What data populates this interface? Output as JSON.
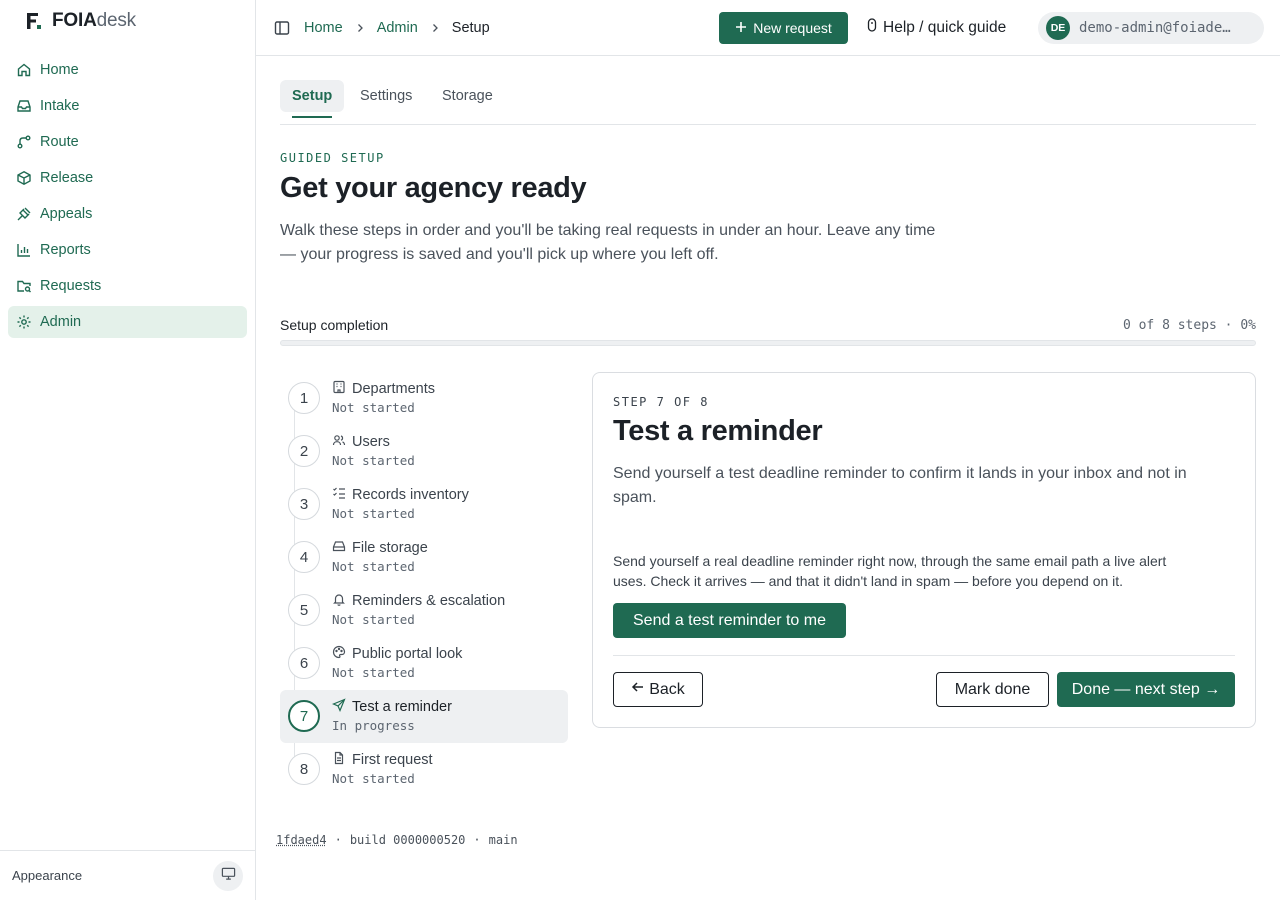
{
  "brand": {
    "name_bold": "FOIA",
    "name_light": "desk"
  },
  "sidebar": {
    "items": [
      {
        "label": "Home",
        "icon": "home-icon"
      },
      {
        "label": "Intake",
        "icon": "inbox-icon"
      },
      {
        "label": "Route",
        "icon": "route-icon"
      },
      {
        "label": "Release",
        "icon": "package-icon"
      },
      {
        "label": "Appeals",
        "icon": "gavel-icon"
      },
      {
        "label": "Reports",
        "icon": "bar-chart-icon"
      },
      {
        "label": "Requests",
        "icon": "folder-search-icon"
      },
      {
        "label": "Admin",
        "icon": "gear-icon",
        "active": true
      }
    ],
    "appearance_label": "Appearance"
  },
  "topbar": {
    "breadcrumbs": [
      "Home",
      "Admin",
      "Setup"
    ],
    "new_request_label": "New request",
    "help_label": "Help / quick guide",
    "user_initials": "DE",
    "user_email": "demo-admin@foiade…"
  },
  "tabs": [
    "Setup",
    "Settings",
    "Storage"
  ],
  "header": {
    "eyebrow": "GUIDED SETUP",
    "title": "Get your agency ready",
    "intro": "Walk these steps in order and you'll be taking real requests in under an hour. Leave any time — your progress is saved and you'll pick up where you left off."
  },
  "completion": {
    "label": "Setup completion",
    "count_text": "0 of 8 steps · 0%",
    "percent": 0
  },
  "steps": [
    {
      "number": "1",
      "title": "Departments",
      "status": "Not started",
      "icon": "building-icon"
    },
    {
      "number": "2",
      "title": "Users",
      "status": "Not started",
      "icon": "users-icon"
    },
    {
      "number": "3",
      "title": "Records inventory",
      "status": "Not started",
      "icon": "list-checks-icon"
    },
    {
      "number": "4",
      "title": "File storage",
      "status": "Not started",
      "icon": "hard-drive-icon"
    },
    {
      "number": "5",
      "title": "Reminders & escalation",
      "status": "Not started",
      "icon": "bell-icon"
    },
    {
      "number": "6",
      "title": "Public portal look",
      "status": "Not started",
      "icon": "palette-icon"
    },
    {
      "number": "7",
      "title": "Test a reminder",
      "status": "In progress",
      "icon": "send-icon",
      "current": true
    },
    {
      "number": "8",
      "title": "First request",
      "status": "Not started",
      "icon": "file-text-icon"
    }
  ],
  "panel": {
    "eyebrow": "STEP 7 OF 8",
    "title": "Test a reminder",
    "lead": "Send yourself a test deadline reminder to confirm it lands in your inbox and not in spam.",
    "body": "Send yourself a real deadline reminder right now, through the same email path a live alert uses. Check it arrives — and that it didn't land in spam — before you depend on it.",
    "send_label": "Send a test reminder to me",
    "back_label": "Back",
    "mark_done_label": "Mark done",
    "next_label": "Done — next step →"
  },
  "build": {
    "commit": "1fdaed4",
    "build": "build 0000000520",
    "branch": "main",
    "sep": "·"
  },
  "colors": {
    "accent": "#1f6a52",
    "accent_soft": "#e4f1ea",
    "text": "#1c2127",
    "muted": "#5c6570",
    "border": "#e2e5e8"
  }
}
